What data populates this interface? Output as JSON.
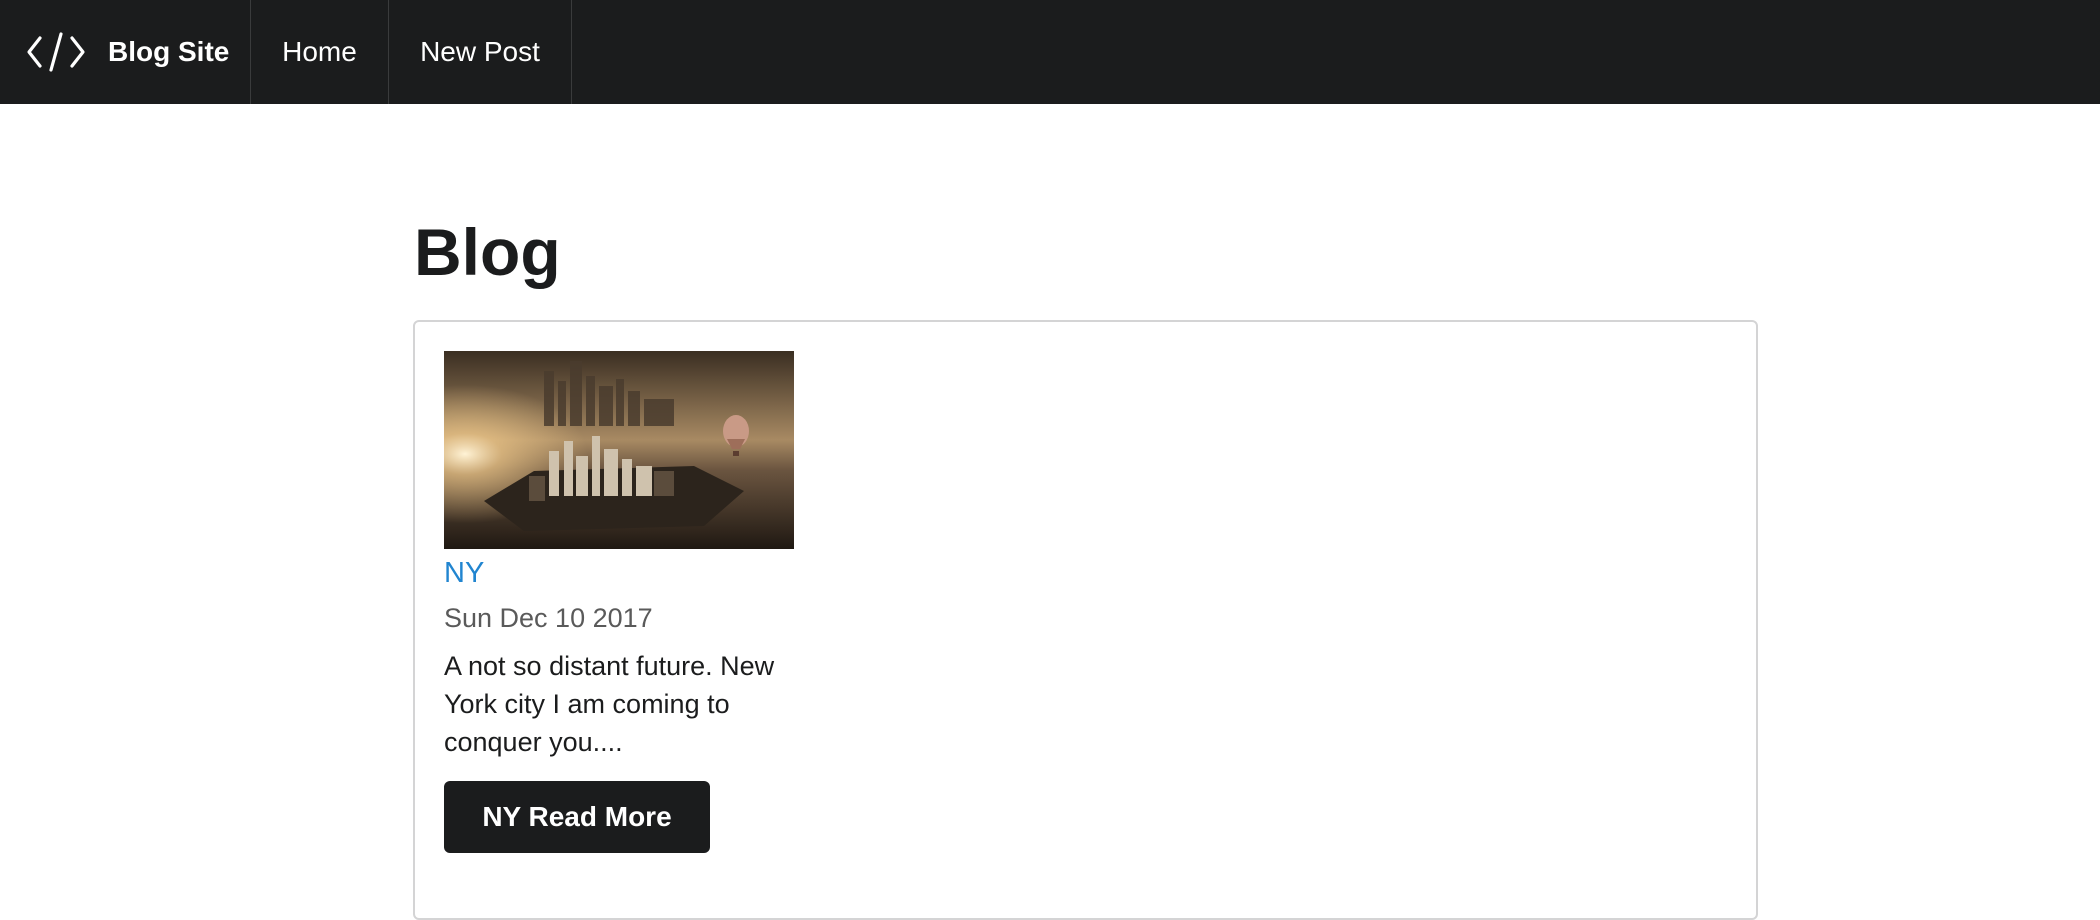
{
  "nav": {
    "brand_label": "Blog Site",
    "brand_icon": "code-icon",
    "home_label": "Home",
    "new_post_label": "New Post"
  },
  "page": {
    "title": "Blog"
  },
  "posts": [
    {
      "title": "NY",
      "date": "Sun Dec 10 2017",
      "excerpt": "A not so distant future. New York city I am coming to conquer you....",
      "read_more_label": "NY Read More"
    }
  ],
  "colors": {
    "navbar_bg": "#1b1c1d",
    "link_blue": "#2185d0",
    "button_bg": "#1b1c1d"
  }
}
